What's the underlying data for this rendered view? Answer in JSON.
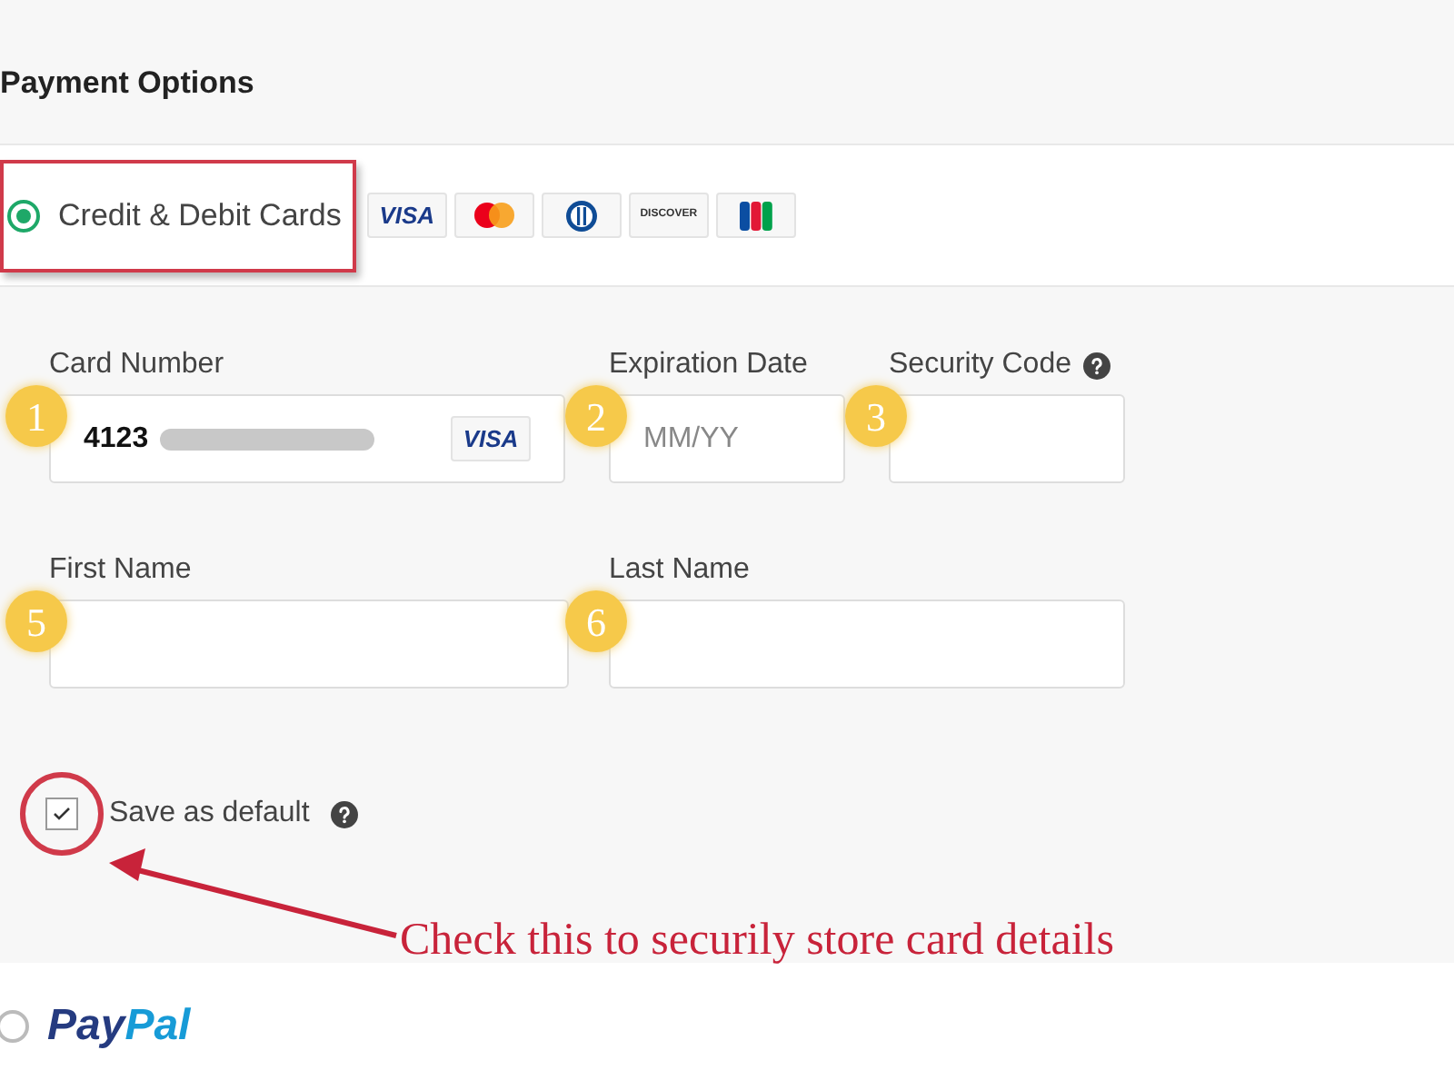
{
  "title": "Payment Options",
  "card_option": {
    "label": "Credit & Debit Cards",
    "selected": true
  },
  "card_logos": [
    {
      "kind": "visa",
      "text": "VISA"
    },
    {
      "kind": "mastercard"
    },
    {
      "kind": "diners"
    },
    {
      "kind": "discover",
      "text": "DISCOVER"
    },
    {
      "kind": "jcb"
    }
  ],
  "fields": [
    {
      "label": "Card Number",
      "value": "4123",
      "marker": "1",
      "brand": "VISA",
      "kind": "card"
    },
    {
      "label": "Expiration Date",
      "placeholder": "MM/YY",
      "marker": "2",
      "kind": "short"
    },
    {
      "label": "Security Code",
      "marker": "3",
      "help": true,
      "kind": "short"
    },
    {
      "label": "First Name",
      "marker": "5",
      "kind": "name"
    },
    {
      "label": "Last Name",
      "marker": "6",
      "kind": "name"
    }
  ],
  "save_default": {
    "label": "Save as default",
    "checked": true,
    "help": true
  },
  "annotation": "Check this to securily store card details",
  "paypal_option": {
    "logo_parts": [
      "Pay",
      "Pal"
    ],
    "selected": false
  }
}
